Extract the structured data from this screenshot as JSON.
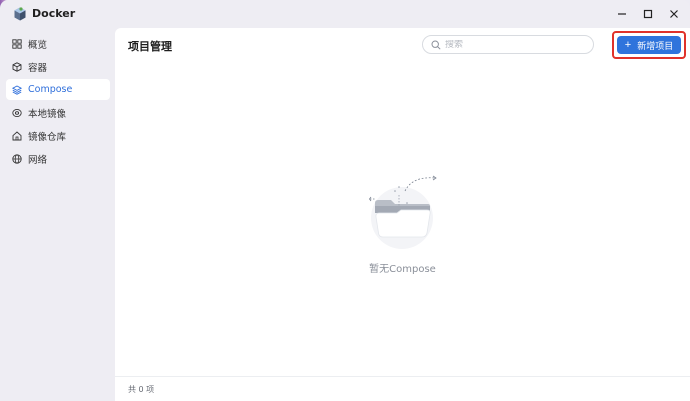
{
  "app": {
    "title": "Docker"
  },
  "sidebar": {
    "items": [
      {
        "label": "概览",
        "icon": "grid-icon",
        "active": false
      },
      {
        "label": "容器",
        "icon": "cube-icon",
        "active": false
      },
      {
        "label": "Compose",
        "icon": "layers-icon",
        "active": true
      },
      {
        "label": "本地镜像",
        "icon": "disc-icon",
        "active": false
      },
      {
        "label": "镜像仓库",
        "icon": "home-icon",
        "active": false
      },
      {
        "label": "网络",
        "icon": "globe-icon",
        "active": false
      }
    ]
  },
  "main": {
    "title": "项目管理",
    "search": {
      "placeholder": "搜索",
      "value": ""
    },
    "add_button": {
      "label": "新增项目"
    },
    "empty": {
      "text": "暂无Compose"
    },
    "footer": {
      "count_text": "共 0 项"
    }
  },
  "colors": {
    "accent": "#2f74dc",
    "highlight": "#e0322a",
    "active_text": "#2f6fdb"
  }
}
